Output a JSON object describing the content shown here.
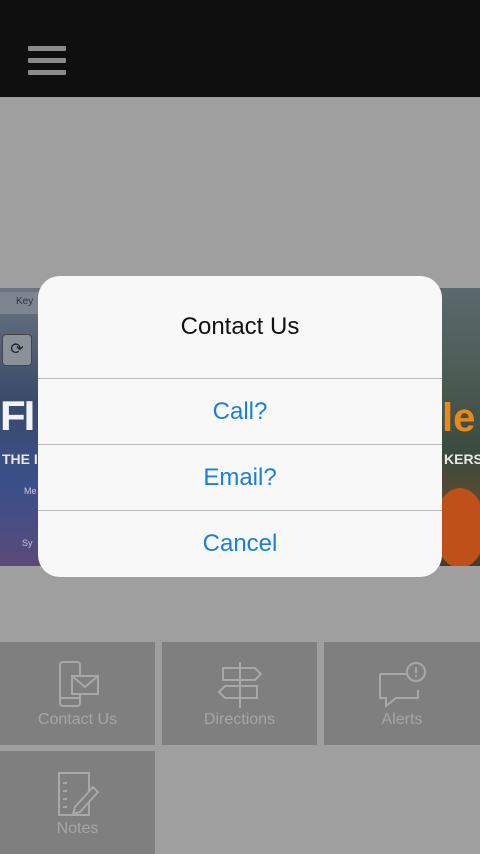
{
  "dialog": {
    "title": "Contact Us",
    "buttons": [
      {
        "label": "Call?"
      },
      {
        "label": "Email?"
      },
      {
        "label": "Cancel"
      }
    ]
  },
  "tiles": [
    {
      "label": "Contact Us",
      "icon": "phone-mail-icon"
    },
    {
      "label": "Directions",
      "icon": "signpost-icon"
    },
    {
      "label": "Alerts",
      "icon": "alert-bubble-icon"
    },
    {
      "label": "Notes",
      "icon": "notes-pencil-icon"
    }
  ],
  "banner": {
    "left_keyboard_text": "Key",
    "left_big_text": "FI",
    "left_line_text": "THE I",
    "left_me_text": "Me",
    "left_sys_text": "Sy",
    "right_big_text": "le",
    "right_line_text": "KERS"
  },
  "colors": {
    "topbar": "#0f0f0f",
    "dialog_button_text": "#1b7fd6",
    "tile_bg": "#7f7f7f"
  }
}
